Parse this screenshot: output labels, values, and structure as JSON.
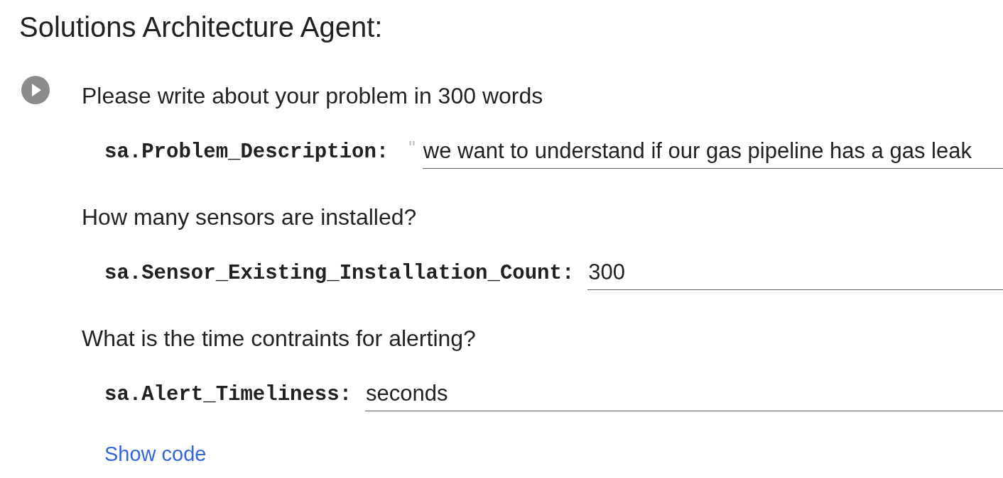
{
  "cell": {
    "title": "Solutions Architecture Agent:",
    "sections": [
      {
        "question": "Please write about your problem in 300 words",
        "field": {
          "label": "sa.Problem_Description:",
          "prefix": "\"",
          "value": "we want to understand if our gas pipeline has a gas leak"
        }
      },
      {
        "question": "How many sensors are installed?",
        "field": {
          "label": "sa.Sensor_Existing_Installation_Count:",
          "value": "300"
        }
      },
      {
        "question": "What is the time contraints for alerting?",
        "field": {
          "label": "sa.Alert_Timeliness:",
          "value": "seconds"
        }
      }
    ],
    "show_code_link": "Show code"
  }
}
